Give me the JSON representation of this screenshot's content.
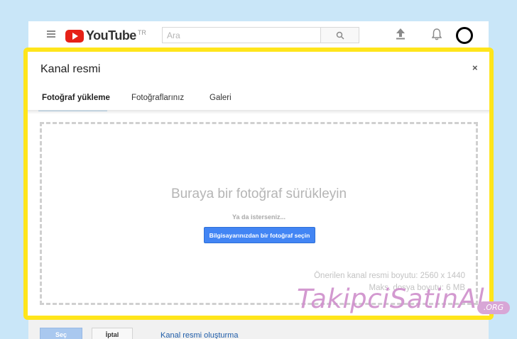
{
  "header": {
    "logo_text": "YouTube",
    "logo_region": "TR",
    "search_placeholder": "Ara",
    "icons": [
      "menu-icon",
      "search-icon",
      "upload-icon",
      "notification-bell-icon",
      "avatar"
    ]
  },
  "dialog": {
    "title": "Kanal resmi",
    "close_label": "×",
    "tabs": [
      {
        "label": "Fotoğraf yükleme",
        "active": true
      },
      {
        "label": "Fotoğraflarınız",
        "active": false
      },
      {
        "label": "Galeri",
        "active": false
      }
    ],
    "dropzone": {
      "title": "Buraya bir fotoğraf sürükleyin",
      "or_text": "Ya da isterseniz...",
      "pick_button": "Bilgisayarınızdan bir fotoğraf seçin",
      "recommended_size": "Önerilen kanal resmi boyutu: 2560 x 1440",
      "max_size": "Maks. dosya boyutu: 6 MB"
    }
  },
  "footer": {
    "select_label": "Seç",
    "cancel_label": "İptal",
    "help_link": "Kanal resmi oluşturma"
  },
  "watermark": {
    "text": "TakipciSatinAl",
    "badge": ".ORG"
  },
  "colors": {
    "highlight_border": "#ffe51b",
    "accent_blue": "#4285f4",
    "tab_underline": "#167ac6",
    "youtube_red": "#e62117",
    "background": "#c9e6f8"
  }
}
